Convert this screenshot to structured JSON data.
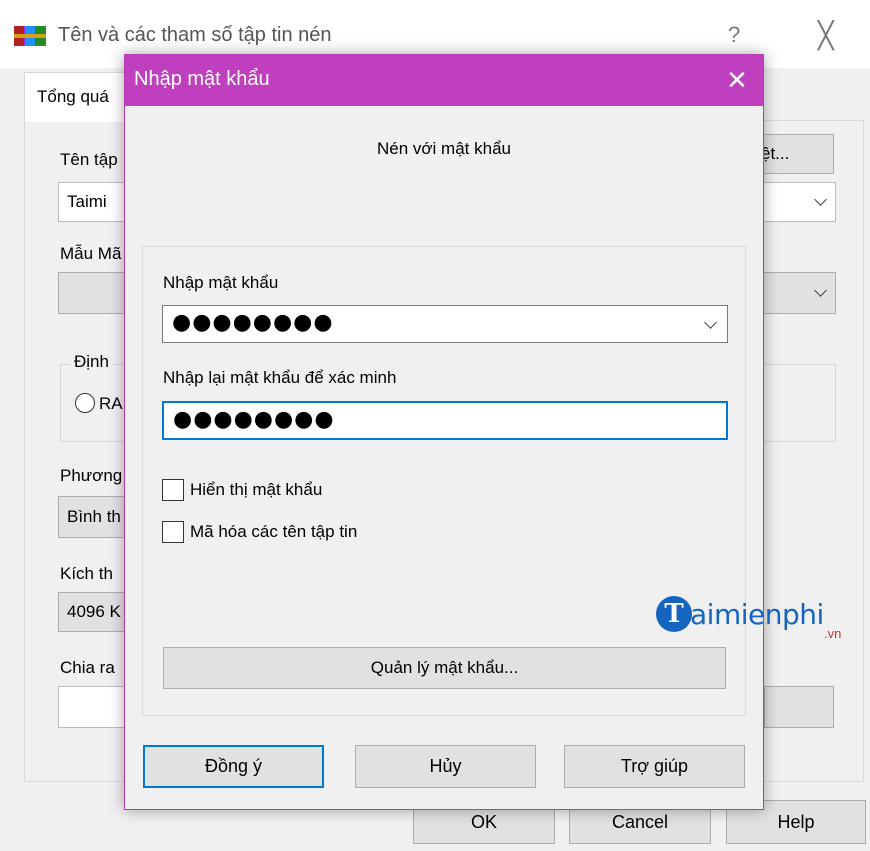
{
  "background_window": {
    "title": "Tên và các tham số tập tin nén",
    "help_symbol": "?",
    "close_symbol": "╳",
    "tab_label": "Tổng quá",
    "archive_name_label": "Tên tập",
    "browse_button_label": "ệt...",
    "archive_name_value": "Taimi",
    "profile_label": "Mẫu Mã",
    "format_group_label": "Định",
    "format_radio_label": "RA",
    "method_label": "Phương",
    "method_value": "Bình th",
    "dictionary_label": "Kích th",
    "dictionary_value": "4096 K",
    "split_label": "Chia ra",
    "ok_label": "OK",
    "cancel_label": "Cancel",
    "help_label": "Help"
  },
  "dialog": {
    "title": "Nhập mật khẩu",
    "close_symbol": "✕",
    "heading": "Nén với mật khẩu",
    "password_label": "Nhập mật khẩu",
    "password_value": "●●●●●●●●",
    "confirm_label": "Nhập lại mật khẩu để xác minh",
    "confirm_value": "●●●●●●●●",
    "show_password_label": "Hiển thị mật khẩu",
    "encrypt_names_label": "Mã hóa các tên tập tin",
    "manage_button_label": "Quản lý mật khẩu...",
    "ok_label": "Đồng ý",
    "cancel_label": "Hủy",
    "help_label": "Trợ giúp"
  },
  "watermark": {
    "logo_letter": "T",
    "logo_text": "aimienphi",
    "logo_suffix": ".vn"
  },
  "colors": {
    "dialog_titlebar": "#c03fbf",
    "focus_border": "#0078d7",
    "watermark_blue": "#1565c0"
  }
}
